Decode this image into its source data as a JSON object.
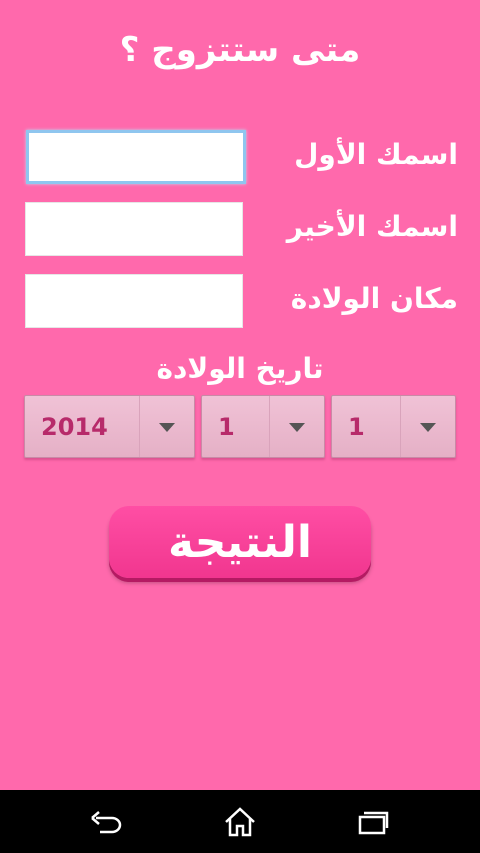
{
  "app": {
    "title": "متى ستتزوج ؟"
  },
  "form": {
    "first_name_label": "اسمك الأول",
    "first_name_value": "",
    "last_name_label": "اسمك الأخير",
    "last_name_value": "",
    "birthplace_label": "مكان الولادة",
    "birthplace_value": "",
    "dob_label": "تاريخ الولادة",
    "year_value": "2014",
    "month_value": "1",
    "day_value": "1"
  },
  "result_button": {
    "label": "النتيجة"
  },
  "navbar": {
    "icons": [
      "back-icon",
      "home-icon",
      "recent-apps-icon"
    ]
  },
  "colors": {
    "background": "#ff69ac",
    "button": "#f1368f",
    "spinner_text": "#b72a6a"
  }
}
